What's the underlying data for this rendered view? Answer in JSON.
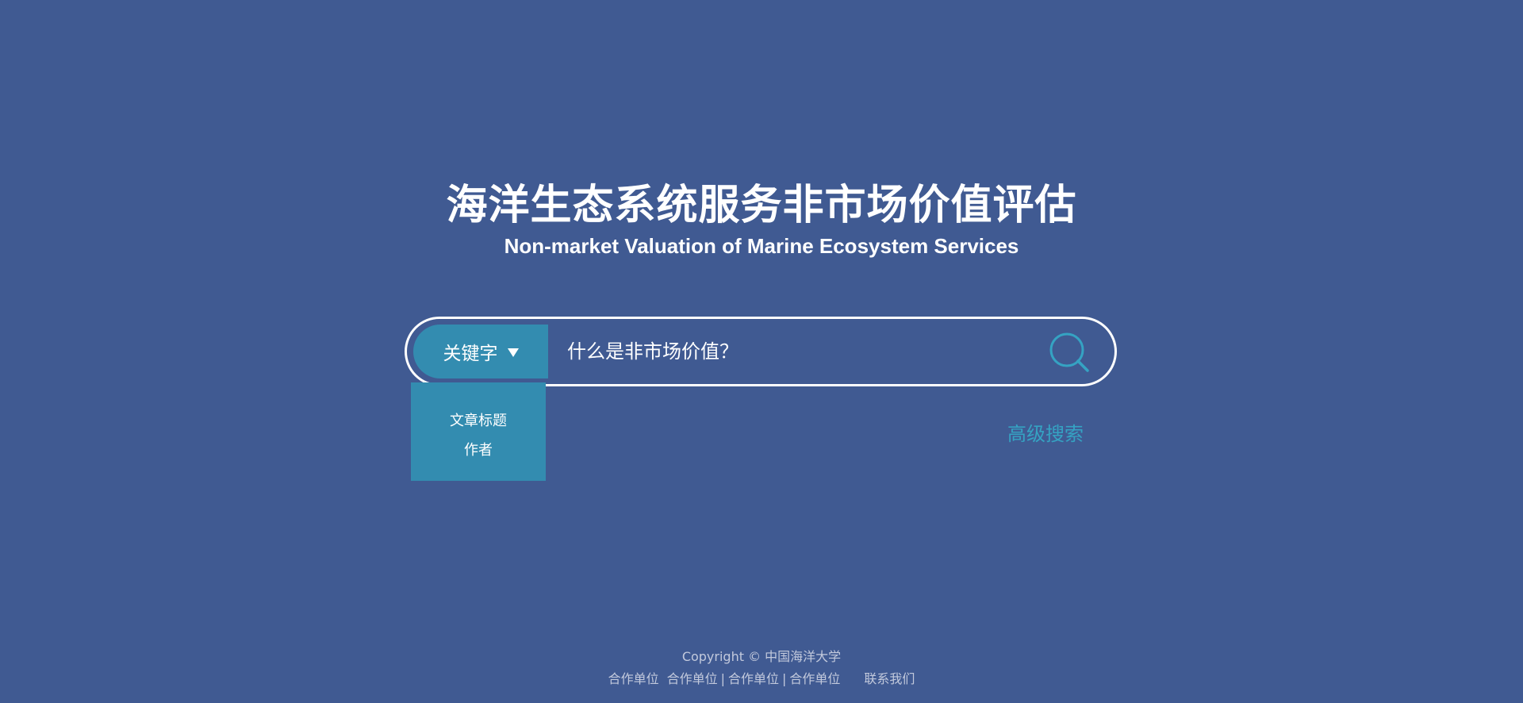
{
  "header": {
    "title_cn": "海洋生态系统服务非市场价值评估",
    "title_en": "Non-market Valuation of Marine Ecosystem Services"
  },
  "search": {
    "selected_option": "关键字",
    "input_value": "什么是非市场价值？",
    "dropdown_options": [
      "文章标题",
      "作者"
    ],
    "advanced_label": "高级搜索",
    "search_icon": "search-icon"
  },
  "footer": {
    "copyright": "Copyright © 中国海洋大学",
    "partners": [
      "合作单位",
      "合作单位",
      "合作单位",
      "合作单位"
    ],
    "contact": "联系我们"
  },
  "colors": {
    "background": "#405a92",
    "accent": "#338cb0",
    "link": "#35a3c3",
    "footer_text": "#c2c9dc"
  }
}
